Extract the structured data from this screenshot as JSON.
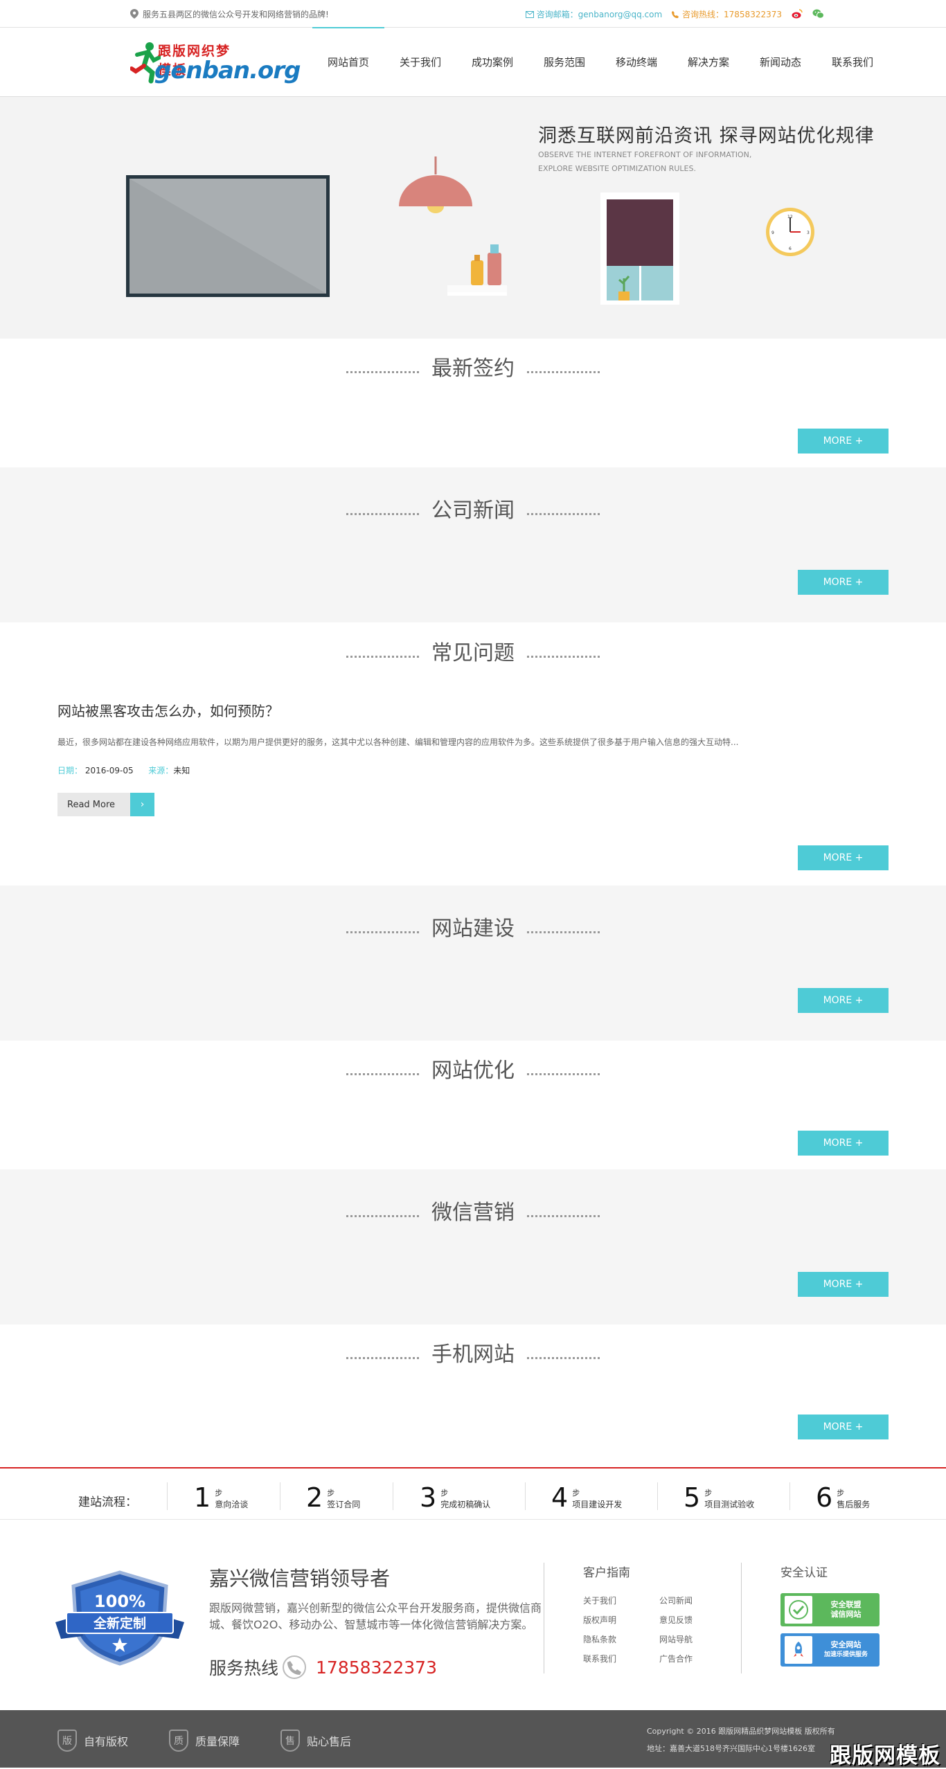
{
  "topbar": {
    "slogan": "服务五县两区的微信公众号开发和网络营销的品牌!",
    "email": "咨询邮箱：genbanorg@qq.com",
    "hotline": "咨询热线：17858322373",
    "weibo_icon": "weibo-icon",
    "wechat_icon": "wechat-icon"
  },
  "logo": {
    "cn": "跟版网织梦模板",
    "en": "genban.org"
  },
  "nav": [
    "网站首页",
    "关于我们",
    "成功案例",
    "服务范围",
    "移动终端",
    "解决方案",
    "新闻动态",
    "联系我们"
  ],
  "banner": {
    "title": "洞悉互联网前沿资讯  探寻网站优化规律",
    "subtitle_line1": "OBSERVE THE INTERNET FOREFRONT OF  INFORMATION,",
    "subtitle_line2": "EXPLORE WEBSITE OPTIMIZATION RULES."
  },
  "sections": {
    "latest": {
      "title": "最新签约",
      "more": "MORE +"
    },
    "news": {
      "title": "公司新闻",
      "more": "MORE +"
    },
    "faq": {
      "title": "常见问题",
      "more": "MORE +",
      "article": {
        "title": "网站被黑客攻击怎么办，如何预防？",
        "desc": "最近，很多网站都在建设各种网络应用软件，以期为用户提供更好的服务，这其中尤以各种创建、编辑和管理内容的应用软件为多。这些系统提供了很多基于用户输入信息的强大互动特...",
        "date_label": "日期：",
        "date": "2016-09-05",
        "source_label": "来源：",
        "source": "未知",
        "read_more": "Read More"
      }
    },
    "build": {
      "title": "网站建设",
      "more": "MORE +"
    },
    "seo": {
      "title": "网站优化",
      "more": "MORE +"
    },
    "wechat": {
      "title": "微信营销",
      "more": "MORE +"
    },
    "mobile": {
      "title": "手机网站",
      "more": "MORE +"
    }
  },
  "process": {
    "label": "建站流程：",
    "step_unit": "步",
    "steps": [
      {
        "num": "1",
        "text": "意向洽谈"
      },
      {
        "num": "2",
        "text": "签订合同"
      },
      {
        "num": "3",
        "text": "完成初稿确认"
      },
      {
        "num": "4",
        "text": "项目建设开发"
      },
      {
        "num": "5",
        "text": "项目测试验收"
      },
      {
        "num": "6",
        "text": "售后服务"
      }
    ]
  },
  "footer": {
    "shield_percent": "100%",
    "shield_text": "全新定制",
    "title": "嘉兴微信营销领导者",
    "desc": "跟版网微营销，嘉兴创新型的微信公众平台开发服务商，提供微信商城、餐饮O2O、移动办公、智慧城市等一体化微信营销解决方案。",
    "hotline_label": "服务热线",
    "hotline": "17858322373",
    "guide_title": "客户指南",
    "guide_links": [
      "关于我们",
      "公司新闻",
      "版权声明",
      "意见反馈",
      "隐私条款",
      "网站导航",
      "联系我们",
      "广告合作"
    ],
    "security_title": "安全认证",
    "badge1_line1": "安全联盟",
    "badge1_line2": "诚信网站",
    "badge2_line1": "安全网站",
    "badge2_line2": "加速乐提供服务"
  },
  "bottom": {
    "items": [
      {
        "glyph": "版",
        "label": "自有版权"
      },
      {
        "glyph": "质",
        "label": "质量保障"
      },
      {
        "glyph": "售",
        "label": "贴心售后"
      }
    ],
    "copyright": "Copyright © 2016 跟版网精品织梦网站模板 版权所有",
    "address": "地址：嘉善大道518号齐兴国际中心1号楼1626室",
    "watermark": "跟版网模板"
  }
}
